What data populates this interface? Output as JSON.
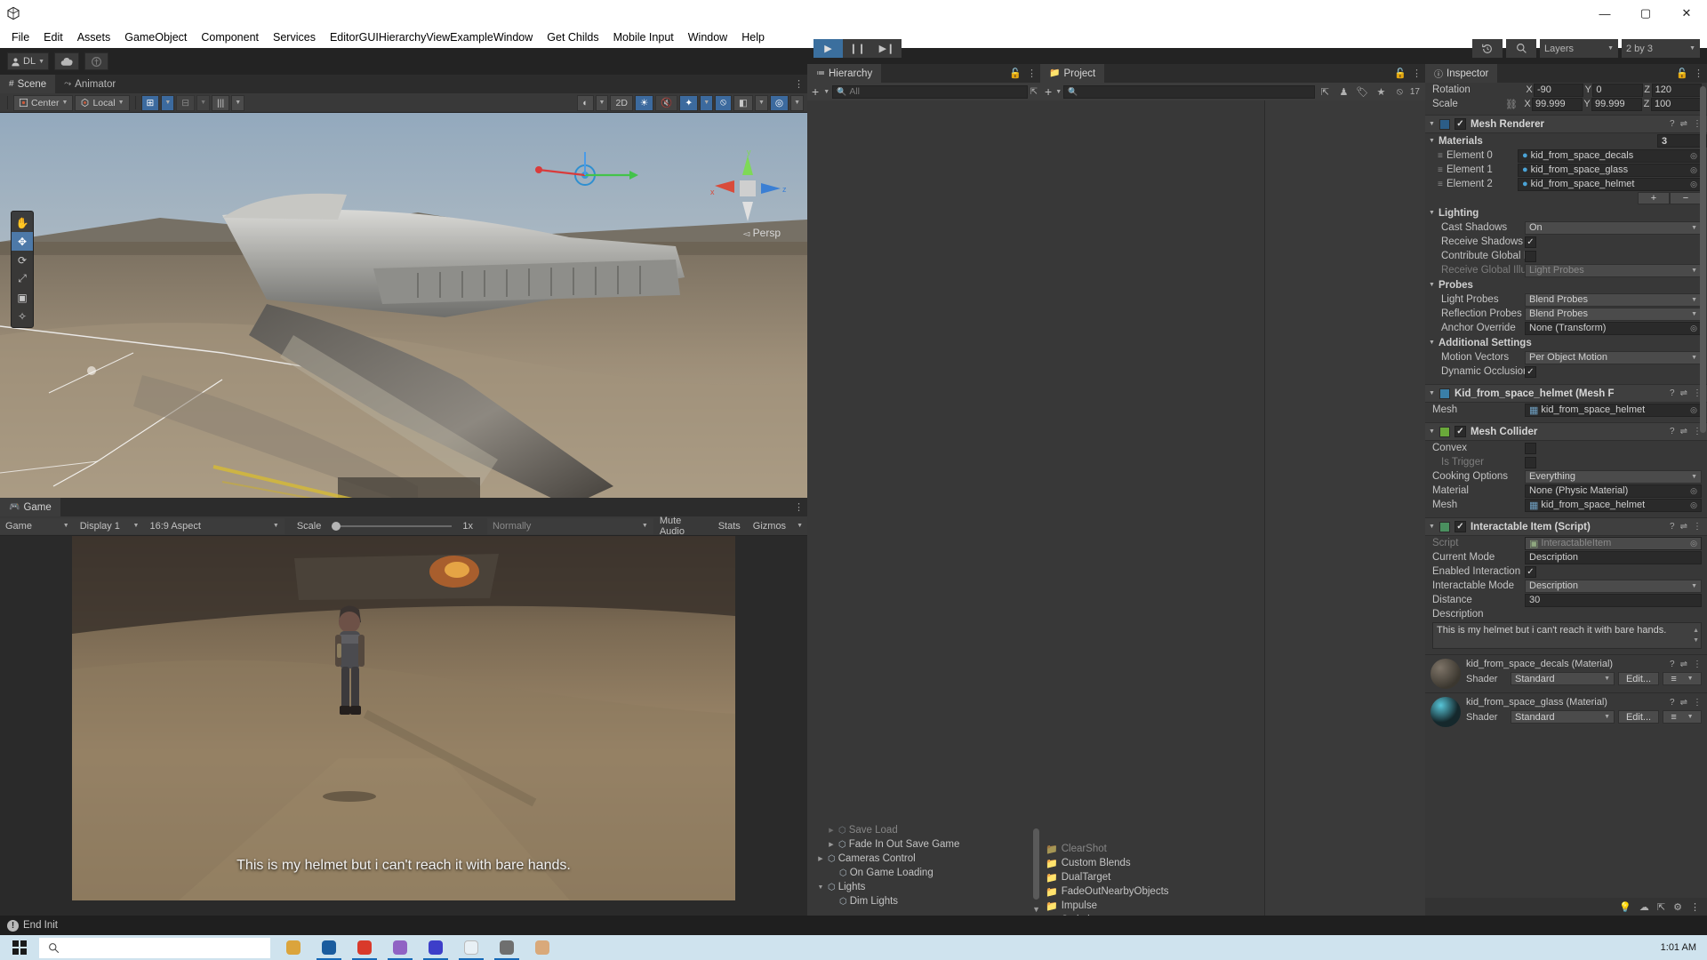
{
  "window": {
    "minimize_label": "—",
    "maximize_label": "▢",
    "close_label": "✕"
  },
  "menubar": {
    "items": [
      {
        "label": "File"
      },
      {
        "label": "Edit"
      },
      {
        "label": "Assets"
      },
      {
        "label": "GameObject"
      },
      {
        "label": "Component"
      },
      {
        "label": "Services"
      },
      {
        "label": "EditorGUIHierarchyViewExampleWindow"
      },
      {
        "label": "Get Childs"
      },
      {
        "label": "Mobile Input"
      },
      {
        "label": "Window"
      },
      {
        "label": "Help"
      }
    ]
  },
  "toolbar": {
    "account_label": "DL",
    "cloud_icon": "cloud-icon",
    "collab_icon": "collab-icon",
    "play_label": "▶",
    "pause_label": "❙❙",
    "step_label": "▶❙",
    "history_icon": "undo-history-icon",
    "search_icon": "search-icon",
    "layers_label": "Layers",
    "layout_label": "2 by 3"
  },
  "scene": {
    "tab_label": "Scene",
    "tab_icon": "grid-icon",
    "animator_tab_label": "Animator",
    "animator_icon": "animator-icon",
    "pivot_label": "Center",
    "space_label": "Local",
    "grid_snap_icon": "grid-snap-icon",
    "snap_increment_icon": "snap-increment-icon",
    "layout_icon": "layout-icon",
    "shading_icon": "shading-mode-icon",
    "mode_2d_label": "2D",
    "light_icon": "lighting-icon",
    "audio_icon": "audio-icon",
    "fx_icon": "effects-icon",
    "hidden_icon": "hidden-objects-icon",
    "scene_cam_icon": "scene-camera-icon",
    "gizmos_icon": "gizmos-icon",
    "persp_label": "Persp",
    "axis_x": "x",
    "axis_y": "y",
    "axis_z": "z",
    "tools": [
      {
        "name": "hand-tool",
        "glyph": "✋"
      },
      {
        "name": "move-tool",
        "glyph": "✥"
      },
      {
        "name": "rotate-tool",
        "glyph": "⟳"
      },
      {
        "name": "scale-tool",
        "glyph": "⤢"
      },
      {
        "name": "rect-tool",
        "glyph": "▢"
      },
      {
        "name": "transform-tool",
        "glyph": "✧"
      }
    ]
  },
  "game": {
    "tab_label": "Game",
    "tab_icon": "gamepad-icon",
    "mode_label": "Game",
    "display_label": "Display 1",
    "aspect_label": "16:9 Aspect",
    "scale_label": "Scale",
    "scale_value": "1x",
    "vsync_label": "Normally",
    "mute_label": "Mute Audio",
    "stats_label": "Stats",
    "gizmos_label": "Gizmos",
    "subtitle": "This is my helmet but i can't reach it with bare hands."
  },
  "hierarchy": {
    "tab_label": "Hierarchy",
    "tab_icon": "hierarchy-icon",
    "lock_icon": "lock-icon",
    "menu_icon": "kebab-menu-icon",
    "add_label": "+",
    "search_placeholder": "All",
    "items": [
      {
        "label": "Save Load",
        "indent": 2,
        "arrow": "▶",
        "cut": true
      },
      {
        "label": "Fade In Out Save Game",
        "indent": 2,
        "arrow": "▶"
      },
      {
        "label": "Cameras Control",
        "indent": 1,
        "arrow": "▶"
      },
      {
        "label": "On Game Loading",
        "indent": 2,
        "arrow": ""
      },
      {
        "label": "Lights",
        "indent": 1,
        "arrow": "▼"
      },
      {
        "label": "Dim Lights",
        "indent": 2,
        "arrow": ""
      }
    ]
  },
  "project": {
    "tab_label": "Project",
    "tab_icon": "folder-icon",
    "lock_icon": "lock-icon",
    "menu_icon": "kebab-menu-icon",
    "add_label": "+",
    "search_placeholder": "",
    "favorites_icon": "favorites-icon",
    "label_icon": "label-icon",
    "star_icon": "star-icon",
    "hidden_count": "17",
    "items": [
      {
        "label": "ClearShot",
        "cut": true
      },
      {
        "label": "Custom Blends"
      },
      {
        "label": "DualTarget"
      },
      {
        "label": "FadeOutNearbyObjects"
      },
      {
        "label": "Impulse"
      },
      {
        "label": "Scripting"
      }
    ]
  },
  "inspector": {
    "tab_label": "Inspector",
    "tab_icon": "info-icon",
    "lock_icon": "lock-icon",
    "menu_icon": "kebab-menu-icon",
    "transform": {
      "rotation_label": "Rotation",
      "rotation": {
        "x_label": "X",
        "x": "-90",
        "y_label": "Y",
        "y": "0",
        "z_label": "Z",
        "z": "120"
      },
      "scale_label": "Scale",
      "scale_link_icon": "constrain-proportions-off-icon",
      "scale": {
        "x_label": "X",
        "x": "99.999",
        "y_label": "Y",
        "y": "99.999",
        "z_label": "Z",
        "z": "100"
      }
    },
    "mesh_renderer": {
      "title": "Mesh Renderer",
      "icon": "mesh-renderer-icon",
      "enabled": true,
      "help_icon": "help-icon",
      "preset_icon": "preset-icon",
      "menu_icon": "kebab-menu-icon",
      "materials_label": "Materials",
      "materials_count": "3",
      "elements": [
        {
          "label": "Element 0",
          "value": "kid_from_space_decals"
        },
        {
          "label": "Element 1",
          "value": "kid_from_space_glass"
        },
        {
          "label": "Element 2",
          "value": "kid_from_space_helmet"
        }
      ],
      "add_label": "+",
      "remove_label": "−",
      "lighting_label": "Lighting",
      "cast_shadows_label": "Cast Shadows",
      "cast_shadows_value": "On",
      "receive_shadows_label": "Receive Shadows",
      "receive_shadows_checked": true,
      "contribute_gi_label": "Contribute Global I",
      "contribute_gi_checked": false,
      "receive_gi_label": "Receive Global Illu",
      "receive_gi_value": "Light Probes",
      "probes_label": "Probes",
      "light_probes_label": "Light Probes",
      "light_probes_value": "Blend Probes",
      "reflection_probes_label": "Reflection Probes",
      "reflection_probes_value": "Blend Probes",
      "anchor_override_label": "Anchor Override",
      "anchor_override_value": "None (Transform)",
      "additional_label": "Additional Settings",
      "motion_vectors_label": "Motion Vectors",
      "motion_vectors_value": "Per Object Motion",
      "dynamic_occlusion_label": "Dynamic Occlusion",
      "dynamic_occlusion_checked": true
    },
    "mesh_filter": {
      "title": "Kid_from_space_helmet (Mesh F",
      "icon": "mesh-filter-icon",
      "mesh_label": "Mesh",
      "mesh_value": "kid_from_space_helmet"
    },
    "mesh_collider": {
      "title": "Mesh Collider",
      "icon": "mesh-collider-icon",
      "enabled": true,
      "convex_label": "Convex",
      "convex_checked": false,
      "is_trigger_label": "Is Trigger",
      "is_trigger_checked": false,
      "cooking_label": "Cooking Options",
      "cooking_value": "Everything",
      "material_label": "Material",
      "material_value": "None (Physic Material)",
      "mesh_label": "Mesh",
      "mesh_value": "kid_from_space_helmet"
    },
    "script_component": {
      "title": "Interactable Item (Script)",
      "icon": "script-icon",
      "enabled": true,
      "script_label": "Script",
      "script_value": "InteractableItem",
      "current_mode_label": "Current Mode",
      "current_mode_value": "Description",
      "enabled_interaction_label": "Enabled Interaction",
      "enabled_interaction_checked": true,
      "interactable_mode_label": "Interactable Mode",
      "interactable_mode_value": "Description",
      "distance_label": "Distance",
      "distance_value": "30",
      "description_label": "Description",
      "description_value": "This is my helmet but i can't reach it with bare hands."
    },
    "materials_preview": [
      {
        "title": "kid_from_space_decals (Material)",
        "shader_label": "Shader",
        "shader_value": "Standard",
        "edit_label": "Edit...",
        "swatch_color": "#55504a"
      },
      {
        "title": "kid_from_space_glass (Material)",
        "shader_label": "Shader",
        "shader_value": "Standard",
        "edit_label": "Edit...",
        "swatch_color": "#1a2a2e"
      }
    ]
  },
  "statusbar": {
    "message": "End Init",
    "icon": "warning-icon"
  },
  "taskbar": {
    "start_icon": "windows-start-icon",
    "search_icon": "search-icon",
    "search_placeholder": "",
    "clock": "1:01 AM",
    "apps": [
      {
        "name": "taskview",
        "color": "#dba43c",
        "active": false
      },
      {
        "name": "explorer",
        "color": "#1a5c9e",
        "active": true
      },
      {
        "name": "app-red",
        "color": "#d93a2b",
        "active": true
      },
      {
        "name": "app-purple",
        "color": "#9063c4",
        "active": true
      },
      {
        "name": "app-blue",
        "color": "#3d3ec9",
        "active": true
      },
      {
        "name": "app-white",
        "color": "#e8f0f5",
        "active": true
      },
      {
        "name": "app-grey",
        "color": "#6f6f6f",
        "active": true
      },
      {
        "name": "app-tan",
        "color": "#d9a97a",
        "active": false
      }
    ]
  }
}
